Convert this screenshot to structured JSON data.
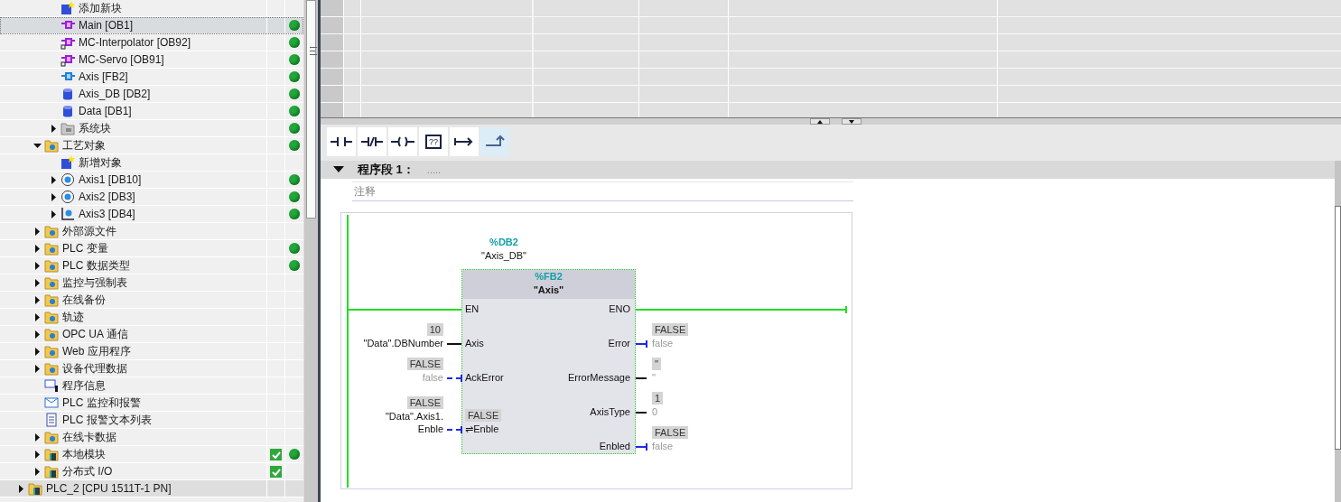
{
  "project_tree": {
    "continued_items": [
      {
        "label": "添加新块",
        "kind": "add",
        "selected": false,
        "online": false,
        "compiled": false
      },
      {
        "label": "Main [OB1]",
        "kind": "ob",
        "selected": true,
        "online": true,
        "compiled": false
      },
      {
        "label": "MC-Interpolator [OB92]",
        "kind": "ob-lock",
        "selected": false,
        "online": true,
        "compiled": false
      },
      {
        "label": "MC-Servo [OB91]",
        "kind": "ob-lock",
        "selected": false,
        "online": true,
        "compiled": false
      },
      {
        "label": "Axis [FB2]",
        "kind": "fb",
        "selected": false,
        "online": true,
        "compiled": false
      },
      {
        "label": "Axis_DB [DB2]",
        "kind": "db",
        "selected": false,
        "online": true,
        "compiled": false
      },
      {
        "label": "Data [DB1]",
        "kind": "db",
        "selected": false,
        "online": true,
        "compiled": false
      },
      {
        "label": "系统块",
        "kind": "system-folder",
        "expanded": false,
        "selected": false,
        "online": true,
        "compiled": false
      }
    ],
    "items": [
      {
        "label": "工艺对象",
        "kind": "folder",
        "expanded": true,
        "selected": false,
        "online": true,
        "compiled": false,
        "children": [
          {
            "label": "新增对象",
            "kind": "add",
            "selected": false,
            "online": false,
            "compiled": false
          },
          {
            "label": "Axis1 [DB10]",
            "kind": "axis",
            "expanded": false,
            "selected": false,
            "online": true,
            "compiled": false
          },
          {
            "label": "Axis2 [DB3]",
            "kind": "axis",
            "expanded": false,
            "selected": false,
            "online": true,
            "compiled": false
          },
          {
            "label": "Axis3 [DB4]",
            "kind": "axis-xy",
            "expanded": false,
            "selected": false,
            "online": true,
            "compiled": false
          }
        ]
      },
      {
        "label": "外部源文件",
        "kind": "folder",
        "expanded": false,
        "selected": false,
        "online": false,
        "compiled": false
      },
      {
        "label": "PLC 变量",
        "kind": "folder",
        "expanded": false,
        "selected": false,
        "online": true,
        "compiled": false
      },
      {
        "label": "PLC 数据类型",
        "kind": "folder",
        "expanded": false,
        "selected": false,
        "online": true,
        "compiled": false
      },
      {
        "label": "监控与强制表",
        "kind": "folder",
        "expanded": false,
        "selected": false,
        "online": false,
        "compiled": false
      },
      {
        "label": "在线备份",
        "kind": "folder",
        "expanded": false,
        "selected": false,
        "online": false,
        "compiled": false
      },
      {
        "label": "轨迹",
        "kind": "folder",
        "expanded": false,
        "selected": false,
        "online": false,
        "compiled": false
      },
      {
        "label": "OPC UA 通信",
        "kind": "folder",
        "expanded": false,
        "selected": false,
        "online": false,
        "compiled": false
      },
      {
        "label": "Web 应用程序",
        "kind": "folder",
        "expanded": false,
        "selected": false,
        "online": false,
        "compiled": false
      },
      {
        "label": "设备代理数据",
        "kind": "folder",
        "expanded": false,
        "selected": false,
        "online": false,
        "compiled": false
      },
      {
        "label": "程序信息",
        "kind": "info",
        "selected": false,
        "online": false,
        "compiled": false
      },
      {
        "label": "PLC 监控和报警",
        "kind": "alarm",
        "selected": false,
        "online": false,
        "compiled": false
      },
      {
        "label": "PLC 报警文本列表",
        "kind": "textlist",
        "selected": false,
        "online": false,
        "compiled": false
      },
      {
        "label": "在线卡数据",
        "kind": "folder",
        "expanded": false,
        "selected": false,
        "online": false,
        "compiled": false
      },
      {
        "label": "本地模块",
        "kind": "device-folder",
        "expanded": false,
        "selected": false,
        "online": true,
        "compiled": true
      },
      {
        "label": "分布式 I/O",
        "kind": "device-folder",
        "expanded": false,
        "selected": false,
        "online": false,
        "compiled": true
      }
    ],
    "root_items": [
      {
        "label": "PLC_2 [CPU 1511T-1 PN]",
        "kind": "device-folder",
        "expanded": false,
        "selected": false,
        "online": false,
        "compiled": false
      }
    ]
  },
  "toolbar": [
    {
      "kind": "no-contact",
      "selected": false
    },
    {
      "kind": "nc-contact",
      "selected": false
    },
    {
      "kind": "coil",
      "selected": false
    },
    {
      "kind": "empty-box",
      "label": "??",
      "selected": false
    },
    {
      "kind": "open-branch",
      "selected": false
    },
    {
      "kind": "close-branch",
      "selected": true
    }
  ],
  "network": {
    "expanded": true,
    "title": "程序段 1：",
    "title_comment": ".....",
    "comment": {
      "placeholder": "注释"
    },
    "block": {
      "instance_address": "%DB2",
      "instance_name": "\"Axis_DB\"",
      "address": "%FB2",
      "name": "\"Axis\"",
      "inputs": [
        {
          "pin": "EN",
          "kind": "power"
        },
        {
          "pin": "Axis",
          "kind": "solid",
          "monitor_value": "10",
          "operand_lines": [
            "\"Data\".DBNumber"
          ],
          "operand_dim": false
        },
        {
          "pin": "AckError",
          "kind": "dashed",
          "monitor_value": "FALSE",
          "operand_lines": [
            "false"
          ],
          "operand_dim": true
        },
        {
          "pin": "⇌Enble",
          "kind": "dashed",
          "inner_value": "FALSE",
          "monitor_value": "FALSE",
          "operand_lines": [
            "\"Data\".Axis1.",
            "Enble"
          ],
          "operand_dim": false
        }
      ],
      "outputs": [
        {
          "pin": "ENO",
          "kind": "power"
        },
        {
          "pin": "Error",
          "kind": "dashed",
          "monitor_value": "FALSE",
          "operand": "false",
          "operand_dim": true
        },
        {
          "pin": "ErrorMessage",
          "kind": "solid",
          "monitor_value": "''",
          "operand": "''",
          "operand_dim": true
        },
        {
          "pin": "AxisType",
          "kind": "solid",
          "monitor_value": "1",
          "operand": "0",
          "operand_dim": true
        },
        {
          "pin": "Enbled",
          "kind": "dashed",
          "monitor_value": "FALSE",
          "operand": "false",
          "operand_dim": true
        }
      ]
    }
  }
}
